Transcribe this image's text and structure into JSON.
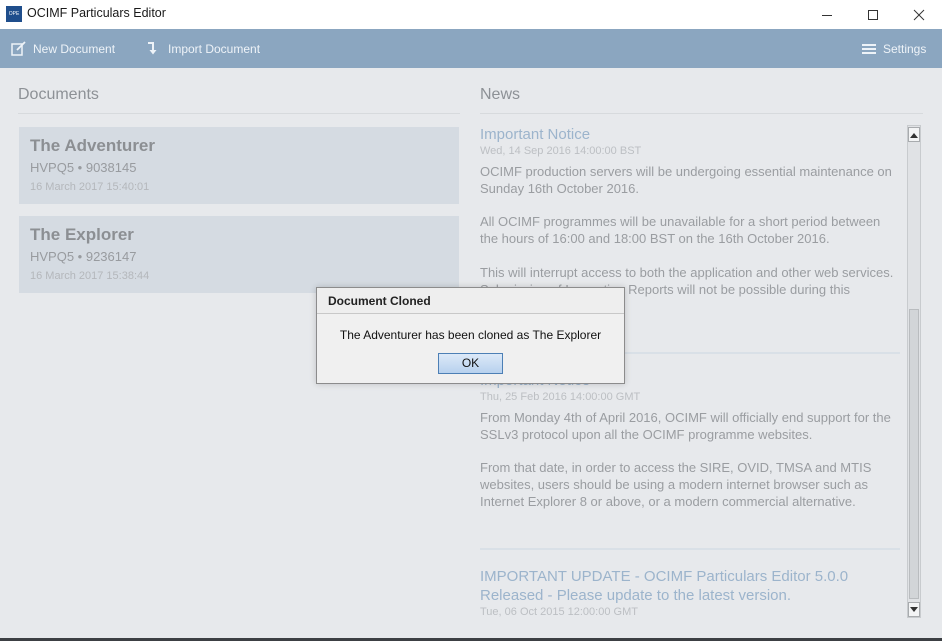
{
  "window": {
    "title": "OCIMF Particulars Editor",
    "icon_text": "OPE",
    "controls": [
      "minimize-icon",
      "maximize-icon",
      "close-icon"
    ]
  },
  "toolbar": {
    "new_document": "New Document",
    "import_document": "Import Document",
    "settings": "Settings",
    "color": "#8ba6c0"
  },
  "documents": {
    "heading": "Documents",
    "items": [
      {
        "name": "The Adventurer",
        "id": "HVPQ5 • 9038145",
        "date": "16 March 2017 15:40:01"
      },
      {
        "name": "The Explorer",
        "id": "HVPQ5 • 9236147",
        "date": "16 March 2017 15:38:44"
      }
    ]
  },
  "news": {
    "heading": "News",
    "items": [
      {
        "title": "Important Notice",
        "date": "Wed, 14 Sep 2016 14:00:00 BST",
        "paragraphs": [
          "OCIMF production servers will be undergoing essential maintenance on Sunday 16th October 2016.",
          "All OCIMF programmes will be unavailable for a short period between the hours of 16:00 and 18:00 BST on the 16th October 2016.",
          "This will interrupt access to both the application and other web services. Submission of Inspection Reports will not be possible during this maintenance period."
        ]
      },
      {
        "title": "Important Notice",
        "date": "Thu, 25 Feb 2016 14:00:00 GMT",
        "paragraphs": [
          "From Monday 4th of April 2016, OCIMF will officially end support for the SSLv3 protocol upon all the OCIMF programme websites.",
          "From that date, in order to access the SIRE, OVID, TMSA and MTIS websites, users should be using a modern internet browser such as Internet Explorer 8 or above, or a modern commercial alternative."
        ]
      },
      {
        "title": "IMPORTANT UPDATE - OCIMF Particulars Editor 5.0.0 Released - Please update to the latest version.",
        "date": "Tue, 06 Oct 2015 12:00:00 GMT",
        "paragraphs": []
      }
    ]
  },
  "dialog": {
    "title": "Document Cloned",
    "message": "The Adventurer has been cloned as The Explorer",
    "ok_label": "OK"
  }
}
